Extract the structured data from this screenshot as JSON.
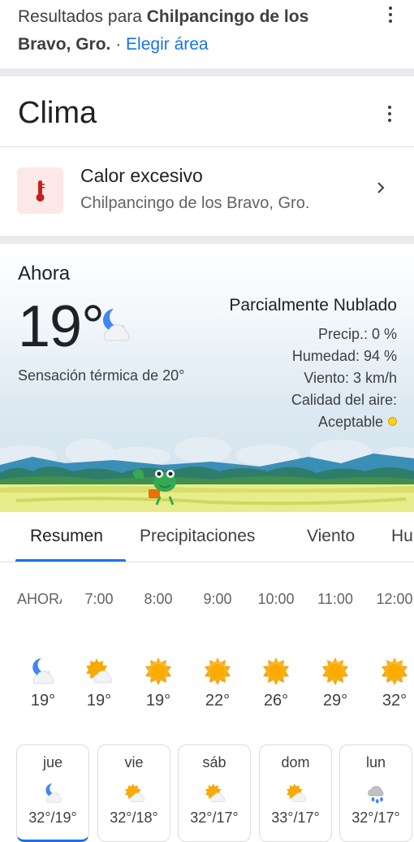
{
  "results": {
    "prefix": "Resultados para ",
    "place_line1": "Chilpancingo de los",
    "place_line2": "Bravo, Gro.",
    "separator": " · ",
    "change_area": "Elegir área"
  },
  "card_title": "Clima",
  "alert": {
    "icon": "thermometer-icon",
    "title": "Calor excesivo",
    "location": "Chilpancingo de los Bravo, Gro."
  },
  "current": {
    "label": "Ahora",
    "temperature": "19°",
    "icon": "partly-cloudy-night-icon",
    "feels_like": "Sensación térmica de 20°",
    "condition": "Parcialmente Nublado",
    "precip": "Precip.: 0 %",
    "humidity": "Humedad: 94 %",
    "wind": "Viento: 3 km/h",
    "air_quality_label": "Calidad del aire:",
    "air_quality_value": "Aceptable",
    "air_quality_color": "#fcd116"
  },
  "tabs": [
    "Resumen",
    "Precipitaciones",
    "Viento",
    "Hu"
  ],
  "hourly": [
    {
      "time": "AHORA",
      "temp": "19°",
      "icon": "partly-cloudy-night-icon"
    },
    {
      "time": "7:00",
      "temp": "19°",
      "icon": "partly-cloudy-day-icon"
    },
    {
      "time": "8:00",
      "temp": "19°",
      "icon": "sun-icon"
    },
    {
      "time": "9:00",
      "temp": "22°",
      "icon": "sun-icon"
    },
    {
      "time": "10:00",
      "temp": "26°",
      "icon": "sun-icon"
    },
    {
      "time": "11:00",
      "temp": "29°",
      "icon": "sun-icon"
    },
    {
      "time": "12:00",
      "temp": "32°",
      "icon": "sun-icon"
    }
  ],
  "daily": [
    {
      "day": "jue",
      "temps": "32°/19°",
      "icon": "partly-cloudy-night-icon"
    },
    {
      "day": "vie",
      "temps": "32°/18°",
      "icon": "partly-cloudy-day-icon"
    },
    {
      "day": "sáb",
      "temps": "32°/17°",
      "icon": "partly-cloudy-day-icon"
    },
    {
      "day": "dom",
      "temps": "33°/17°",
      "icon": "partly-cloudy-day-icon"
    },
    {
      "day": "lun",
      "temps": "32°/17°",
      "icon": "rain-icon"
    }
  ],
  "colors": {
    "link": "#1a73e8",
    "sun": "#f9ab00",
    "moon": "#4285f4",
    "alert_bg": "#fce8e6",
    "alert_icon": "#c5221f"
  }
}
